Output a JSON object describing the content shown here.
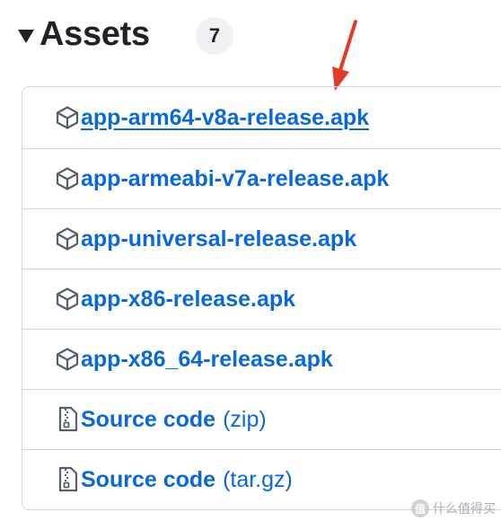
{
  "header": {
    "title": "Assets",
    "count": "7"
  },
  "assets": [
    {
      "icon": "package-icon",
      "name": "app-arm64-v8a-release.apk",
      "suffix": ""
    },
    {
      "icon": "package-icon",
      "name": "app-armeabi-v7a-release.apk",
      "suffix": ""
    },
    {
      "icon": "package-icon",
      "name": "app-universal-release.apk",
      "suffix": ""
    },
    {
      "icon": "package-icon",
      "name": "app-x86-release.apk",
      "suffix": ""
    },
    {
      "icon": "package-icon",
      "name": "app-x86_64-release.apk",
      "suffix": ""
    },
    {
      "icon": "file-zip-icon",
      "name": "Source code",
      "suffix": "(zip)"
    },
    {
      "icon": "file-zip-icon",
      "name": "Source code",
      "suffix": "(tar.gz)"
    }
  ],
  "watermark": {
    "badge": "值",
    "text": "什么值得买"
  },
  "colors": {
    "link": "#0969da",
    "border": "#d0d7de",
    "arrow": "#e5392a"
  }
}
